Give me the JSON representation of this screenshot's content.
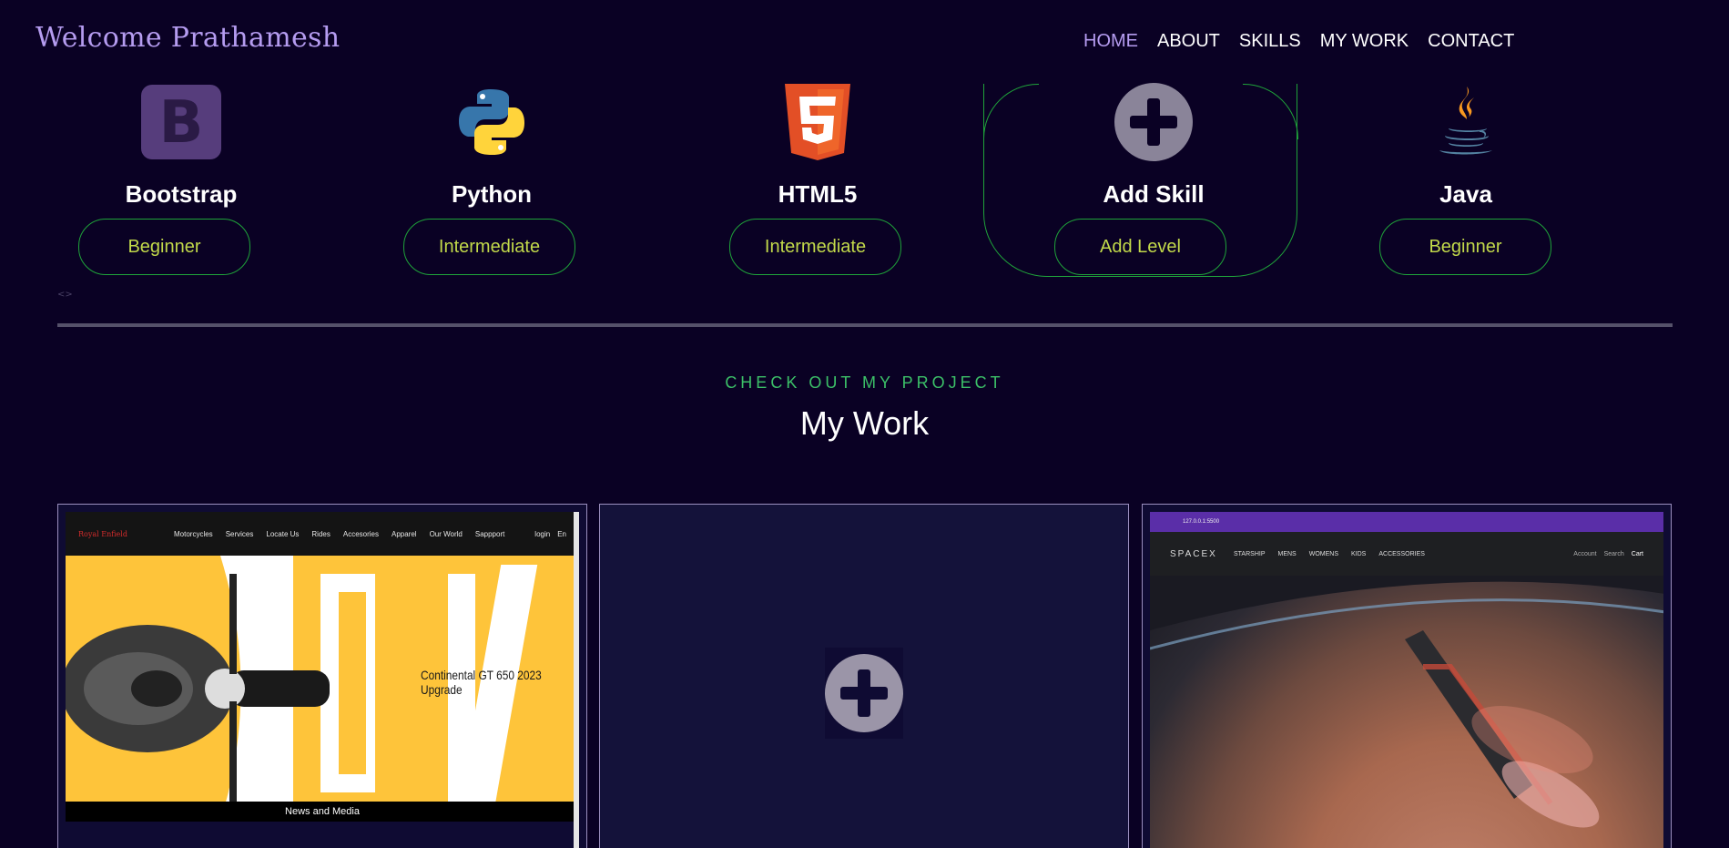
{
  "header": {
    "brand": "Welcome Prathamesh",
    "nav": [
      "HOME",
      "ABOUT",
      "SKILLS",
      "MY WORK",
      "CONTACT"
    ],
    "active_nav": "HOME"
  },
  "skills": [
    {
      "name": "Bootstrap",
      "level": "Beginner",
      "icon": "bootstrap-icon"
    },
    {
      "name": "Python",
      "level": "Intermediate",
      "icon": "python-icon"
    },
    {
      "name": "HTML5",
      "level": "Intermediate",
      "icon": "html5-icon"
    },
    {
      "name": "Add Skill",
      "level": "Add Level",
      "icon": "plus-icon"
    },
    {
      "name": "Java",
      "level": "Beginner",
      "icon": "java-icon"
    }
  ],
  "scroll_indicator": "<>",
  "work": {
    "eyebrow": "CHECK OUT MY PROJECT",
    "title": "My Work"
  },
  "projects": {
    "royal_enfield": {
      "logo": "Royal Enfield",
      "links": [
        "Motorcycles",
        "Services",
        "Locate Us",
        "Rides",
        "Accesories",
        "Apparel",
        "Our World",
        "Sappport"
      ],
      "login": "login",
      "lang": "En",
      "hero_caption": "Continental GT 650 2023 Upgrade",
      "footer_caption": "News and Media"
    },
    "add_project": {
      "icon": "plus-icon"
    },
    "spacex": {
      "url": "127.0.0.1:5500",
      "logo": "SPACEX",
      "links": [
        "STARSHIP",
        "MENS",
        "WOMENS",
        "KIDS",
        "ACCESSORIES"
      ],
      "right_links": [
        "Account",
        "Search",
        "Cart"
      ]
    }
  },
  "colors": {
    "background": "#0a0124",
    "accent": "#b59cf0",
    "border_green": "#1fa33a",
    "level_text": "#c2d94a",
    "eyebrow": "#3cc068"
  }
}
